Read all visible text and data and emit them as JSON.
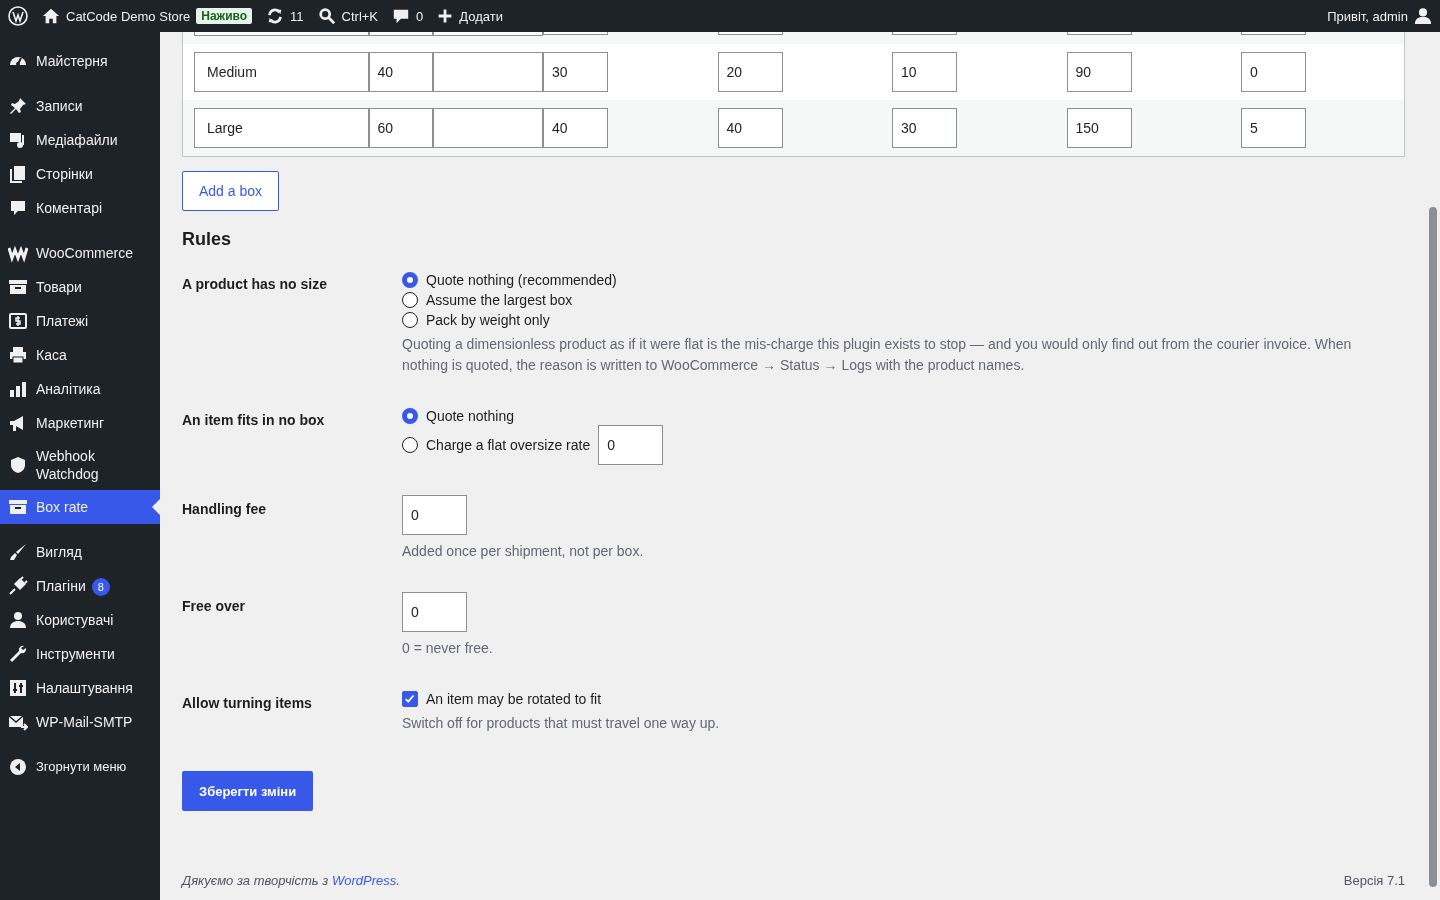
{
  "admin_bar": {
    "site_name": "CatCode Demo Store",
    "live_badge": "Наживо",
    "updates": "11",
    "search": "Ctrl+K",
    "comments": "0",
    "new": "Додати",
    "greeting": "Привіт, admin"
  },
  "sidebar": {
    "groups": [
      [
        {
          "label": "Майстерня",
          "selected": false
        }
      ],
      [
        {
          "label": "Записи",
          "selected": false
        },
        {
          "label": "Медіафайли",
          "selected": false
        },
        {
          "label": "Сторінки",
          "selected": false
        },
        {
          "label": "Коментарі",
          "selected": false
        }
      ],
      [
        {
          "label": "WooCommerce",
          "selected": false
        },
        {
          "label": "Товари",
          "selected": false
        },
        {
          "label": "Платежі",
          "selected": false
        },
        {
          "label": "Каса",
          "selected": false
        },
        {
          "label": "Аналітика",
          "selected": false
        },
        {
          "label": "Маркетинг",
          "selected": false
        },
        {
          "label": "Webhook Watchdog",
          "selected": false
        },
        {
          "label": "Box rate",
          "selected": true
        }
      ],
      [
        {
          "label": "Вигляд",
          "selected": false
        },
        {
          "label": "Плагіни",
          "selected": false,
          "badge": "8"
        },
        {
          "label": "Користувачі",
          "selected": false
        },
        {
          "label": "Інструменти",
          "selected": false
        },
        {
          "label": "Налаштування",
          "selected": false
        },
        {
          "label": "WP-Mail-SMTP",
          "selected": false
        }
      ]
    ],
    "collapse": "Згорнути меню"
  },
  "boxes": {
    "rows": [
      {
        "name": "Medium",
        "values": [
          "40",
          "30",
          "20",
          "10",
          "90",
          "0"
        ]
      },
      {
        "name": "Large",
        "values": [
          "60",
          "40",
          "40",
          "30",
          "150",
          "5"
        ]
      }
    ]
  },
  "add_button": "Add a box",
  "rules": {
    "title": "Rules",
    "rows": [
      {
        "kind": "radios",
        "label": "A product has no size",
        "options": [
          {
            "label": "Quote nothing (recommended)",
            "selected": true
          },
          {
            "label": "Assume the largest box",
            "selected": false
          },
          {
            "label": "Pack by weight only",
            "selected": false
          }
        ],
        "description": "Quoting a dimensionless product as if it were flat is the mis-charge this plugin exists to stop — and you would only find out from the courier invoice. When nothing is quoted, the reason is written to WooCommerce → Status → Logs with the product names."
      },
      {
        "kind": "radios",
        "label": "An item fits in no box",
        "options": [
          {
            "label": "Quote nothing",
            "selected": true
          },
          {
            "label": "Charge a flat oversize rate",
            "selected": false,
            "value": "0"
          }
        ]
      },
      {
        "kind": "input",
        "label": "Handling fee",
        "value": "0",
        "description": "Added once per shipment, not per box."
      },
      {
        "kind": "input",
        "label": "Free over",
        "value": "0",
        "description": "0 = never free."
      },
      {
        "kind": "checkbox",
        "label": "Allow turning items",
        "option": "An item may be rotated to fit",
        "checked": true,
        "description": "Switch off for products that must travel one way up."
      }
    ]
  },
  "save_button": "Зберегти зміни",
  "footer": {
    "text": "Дякуємо за творчість з",
    "link": "WordPress",
    "after": ".",
    "version": "Версія 7.1"
  }
}
